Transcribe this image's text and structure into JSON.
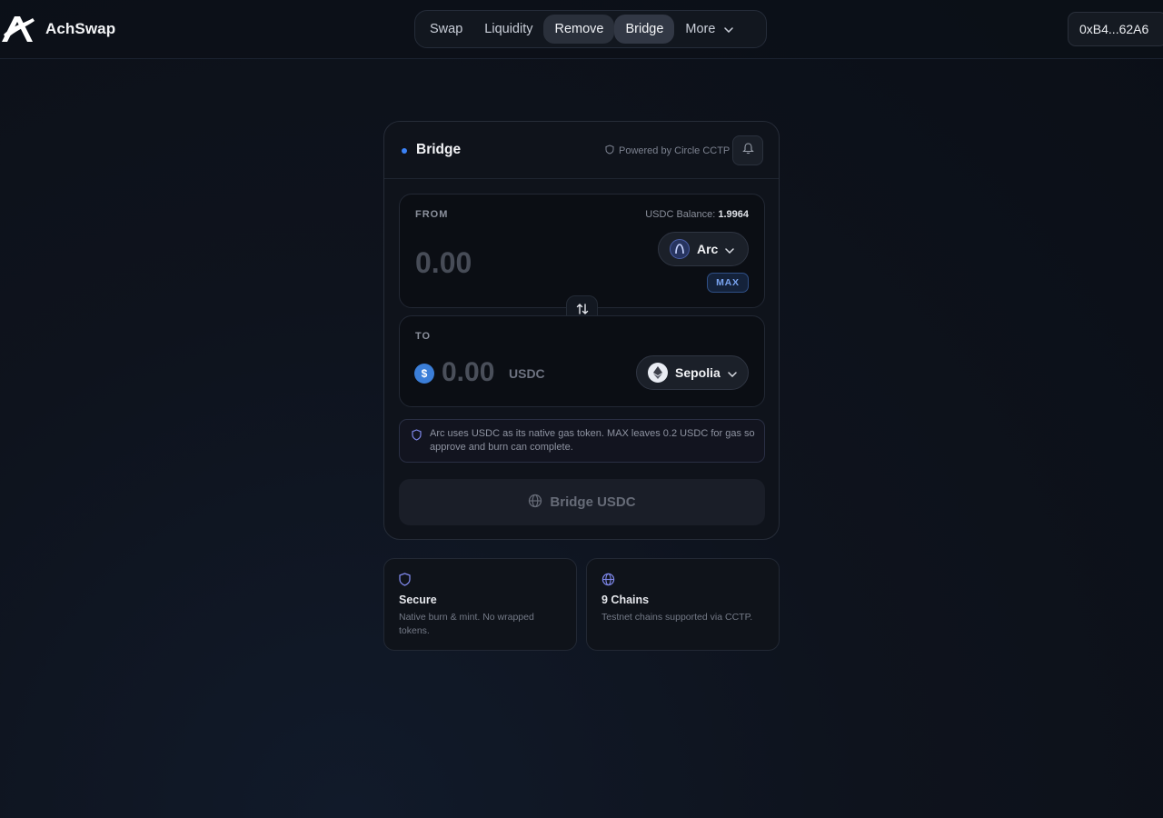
{
  "header": {
    "brand": "AchSwap",
    "nav": [
      {
        "label": "Swap"
      },
      {
        "label": "Liquidity"
      },
      {
        "label": "Remove"
      },
      {
        "label": "Bridge"
      },
      {
        "label": "More"
      }
    ],
    "wallet": "0xB4...62A6"
  },
  "card": {
    "title": "Bridge",
    "powered_by": "Powered by Circle CCTP",
    "from": {
      "label": "FROM",
      "balance_label": "USDC Balance:",
      "balance_value": "1.9964",
      "amount_placeholder": "0.00",
      "chain": "Arc",
      "max_label": "MAX"
    },
    "to": {
      "label": "TO",
      "amount": "0.00",
      "unit": "USDC",
      "chain": "Sepolia"
    },
    "info": "Arc uses USDC as its native gas token. MAX leaves 0.2 USDC for gas so approve and burn can complete.",
    "action_label": "Bridge USDC"
  },
  "features": [
    {
      "title": "Secure",
      "desc": "Native burn & mint. No wrapped tokens."
    },
    {
      "title": "9 Chains",
      "desc": "Testnet chains supported via CCTP."
    }
  ]
}
